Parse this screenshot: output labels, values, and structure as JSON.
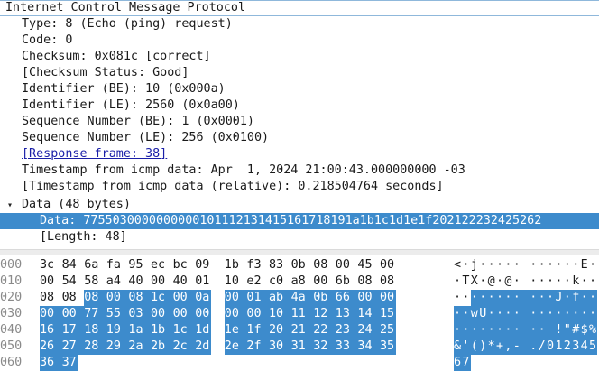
{
  "details": {
    "title": "Internet Control Message Protocol",
    "type": "Type: 8 (Echo (ping) request)",
    "code": "Code: 0",
    "checksum": "Checksum: 0x081c [correct]",
    "checksum_status": "[Checksum Status: Good]",
    "identifier_be": "Identifier (BE): 10 (0x000a)",
    "identifier_le": "Identifier (LE): 2560 (0x0a00)",
    "seq_be": "Sequence Number (BE): 1 (0x0001)",
    "seq_le": "Sequence Number (LE): 256 (0x0100)",
    "response_frame": "[Response frame: 38]",
    "timestamp": "Timestamp from icmp data: Apr  1, 2024 21:00:43.000000000 -03",
    "timestamp_rel": "[Timestamp from icmp data (relative): 0.218504764 seconds]",
    "data_toggle": "▾",
    "data_node": "Data (48 bytes)",
    "data_value": "Data: 7755030000000000101112131415161718191a1b1c1d1e1f202122232425262",
    "length": "[Length: 48]"
  },
  "hex": {
    "rows": [
      {
        "offset": "000",
        "bytes": [
          "3c",
          "84",
          "6a",
          "fa",
          "95",
          "ec",
          "bc",
          "09",
          "1b",
          "f3",
          "83",
          "0b",
          "08",
          "00",
          "45",
          "00"
        ],
        "ascii": [
          "<",
          "·",
          "j",
          "·",
          "·",
          "·",
          "·",
          "·",
          "·",
          "·",
          "·",
          "·",
          "·",
          "·",
          "E",
          "·"
        ]
      },
      {
        "offset": "010",
        "bytes": [
          "00",
          "54",
          "58",
          "a4",
          "40",
          "00",
          "40",
          "01",
          "10",
          "e2",
          "c0",
          "a8",
          "00",
          "6b",
          "08",
          "08"
        ],
        "ascii": [
          "·",
          "T",
          "X",
          "·",
          "@",
          "·",
          "@",
          "·",
          "·",
          "·",
          "·",
          "·",
          "·",
          "k",
          "·",
          "·"
        ]
      },
      {
        "offset": "020",
        "bytes": [
          "08",
          "08",
          "08",
          "00",
          "08",
          "1c",
          "00",
          "0a",
          "00",
          "01",
          "ab",
          "4a",
          "0b",
          "66",
          "00",
          "00"
        ],
        "ascii": [
          "·",
          "·",
          "·",
          "·",
          "·",
          "·",
          "·",
          "·",
          "·",
          "·",
          "·",
          "J",
          "·",
          "f",
          "·",
          "·"
        ]
      },
      {
        "offset": "030",
        "bytes": [
          "00",
          "00",
          "77",
          "55",
          "03",
          "00",
          "00",
          "00",
          "00",
          "00",
          "10",
          "11",
          "12",
          "13",
          "14",
          "15"
        ],
        "ascii": [
          "·",
          "·",
          "w",
          "U",
          "·",
          "·",
          "·",
          "·",
          "·",
          "·",
          "·",
          "·",
          "·",
          "·",
          "·",
          "·"
        ]
      },
      {
        "offset": "040",
        "bytes": [
          "16",
          "17",
          "18",
          "19",
          "1a",
          "1b",
          "1c",
          "1d",
          "1e",
          "1f",
          "20",
          "21",
          "22",
          "23",
          "24",
          "25"
        ],
        "ascii": [
          "·",
          "·",
          "·",
          "·",
          "·",
          "·",
          "·",
          "·",
          "·",
          "·",
          " ",
          "!",
          "\"",
          "#",
          "$",
          "%"
        ]
      },
      {
        "offset": "050",
        "bytes": [
          "26",
          "27",
          "28",
          "29",
          "2a",
          "2b",
          "2c",
          "2d",
          "2e",
          "2f",
          "30",
          "31",
          "32",
          "33",
          "34",
          "35"
        ],
        "ascii": [
          "&",
          "'",
          "(",
          ")",
          "*",
          "+",
          ",",
          "-",
          ".",
          "/",
          "0",
          "1",
          "2",
          "3",
          "4",
          "5"
        ]
      },
      {
        "offset": "060",
        "bytes": [
          "36",
          "37"
        ],
        "ascii": [
          "6",
          "7"
        ]
      }
    ]
  }
}
